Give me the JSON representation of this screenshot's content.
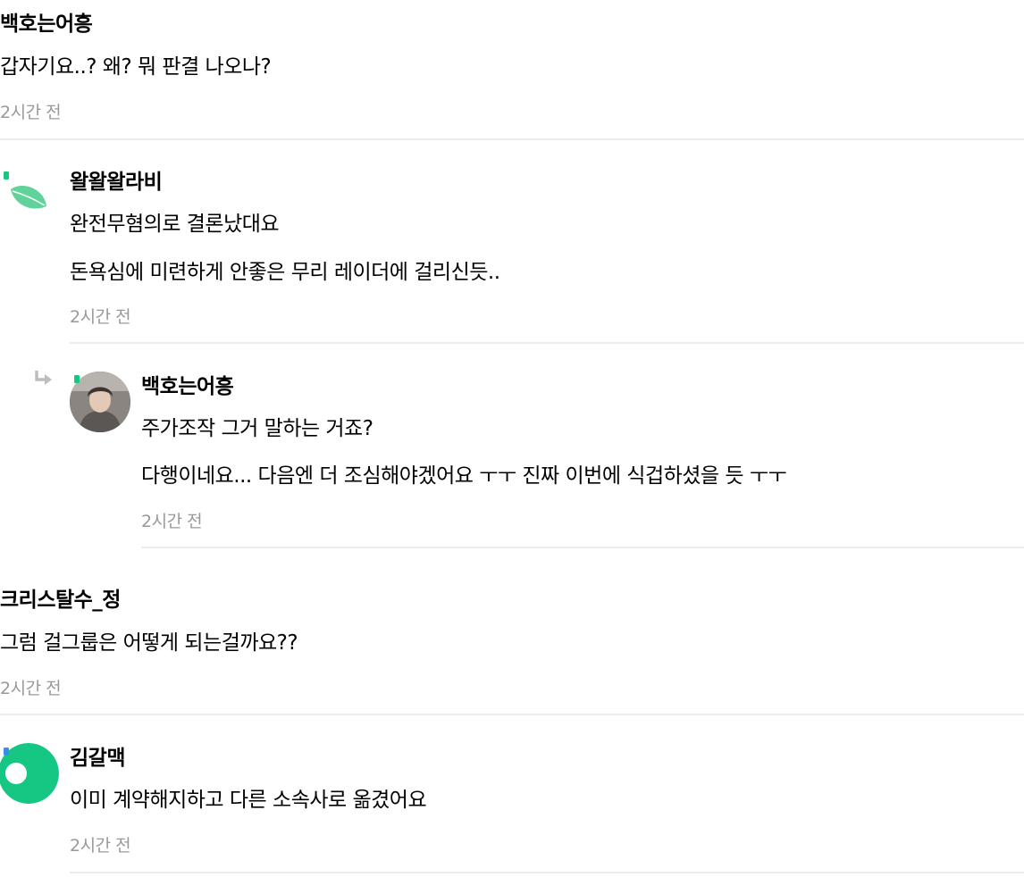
{
  "comments": [
    {
      "nickname": "백호는어흥",
      "lines": [
        "갑자기요..? 왜? 뭐 판결 나오나?"
      ],
      "time": "2시간 전",
      "reply": {
        "nickname": "왈왈왈라비",
        "lines": [
          "완전무혐의로 결론났대요",
          "돈욕심에 미련하게 안좋은 무리 레이더에 걸리신듯.."
        ],
        "time": "2시간 전",
        "reply": {
          "nickname": "백호는어흥",
          "lines": [
            "주가조작 그거 말하는 거죠?",
            "다행이네요... 다음엔 더 조심해야겠어요 ㅜㅜ 진짜 이번에 식겁하셨을 듯 ㅜㅜ"
          ],
          "time": "2시간 전"
        }
      }
    },
    {
      "nickname": "크리스탈수_정",
      "lines": [
        "그럼 걸그룹은 어떻게 되는걸까요??"
      ],
      "time": "2시간 전",
      "reply": {
        "nickname": "김갈맥",
        "lines": [
          "이미 계약해지하고 다른 소속사로 옮겼어요"
        ],
        "time": "2시간 전"
      }
    }
  ],
  "icons": {
    "reply_arrow": "reply-arrow-icon",
    "avatar_leaf": "leaf-avatar-icon",
    "avatar_photo": "user-photo-avatar",
    "avatar_ring": "green-ring-avatar-icon"
  },
  "colors": {
    "time": "#999999",
    "divider": "#ececec",
    "leaf": "#5fd39a",
    "ring": "#16c784",
    "badge_green": "#16c784",
    "badge_blue": "#3a8ee6",
    "reply_arrow": "#bdbdbd"
  }
}
